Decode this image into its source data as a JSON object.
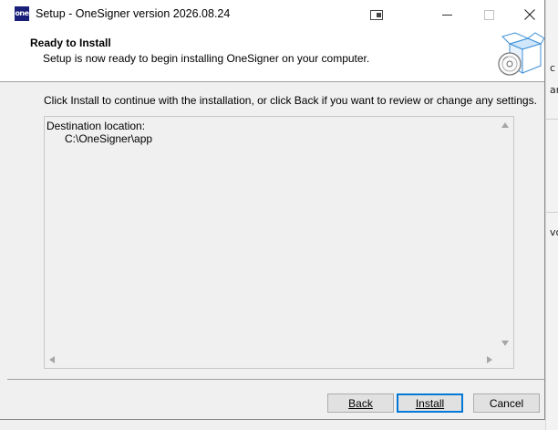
{
  "window": {
    "title": "Setup - OneSigner version 2026.08.24",
    "app_icon_text": "one"
  },
  "header": {
    "title": "Ready to Install",
    "subtitle": "Setup is now ready to begin installing OneSigner on your computer."
  },
  "body": {
    "instruction": "Click Install to continue with the installation, or click Back if you want to review or change any settings.",
    "memo": {
      "label": "Destination location:",
      "value": "C:\\OneSigner\\app"
    }
  },
  "buttons": {
    "back": "Back",
    "install": "Install",
    "cancel": "Cancel"
  },
  "background_window": {
    "fragments": [
      "c",
      "ar",
      "vo"
    ]
  },
  "colors": {
    "accent": "#0078d7",
    "app_icon_bg": "#1a1f7a"
  }
}
